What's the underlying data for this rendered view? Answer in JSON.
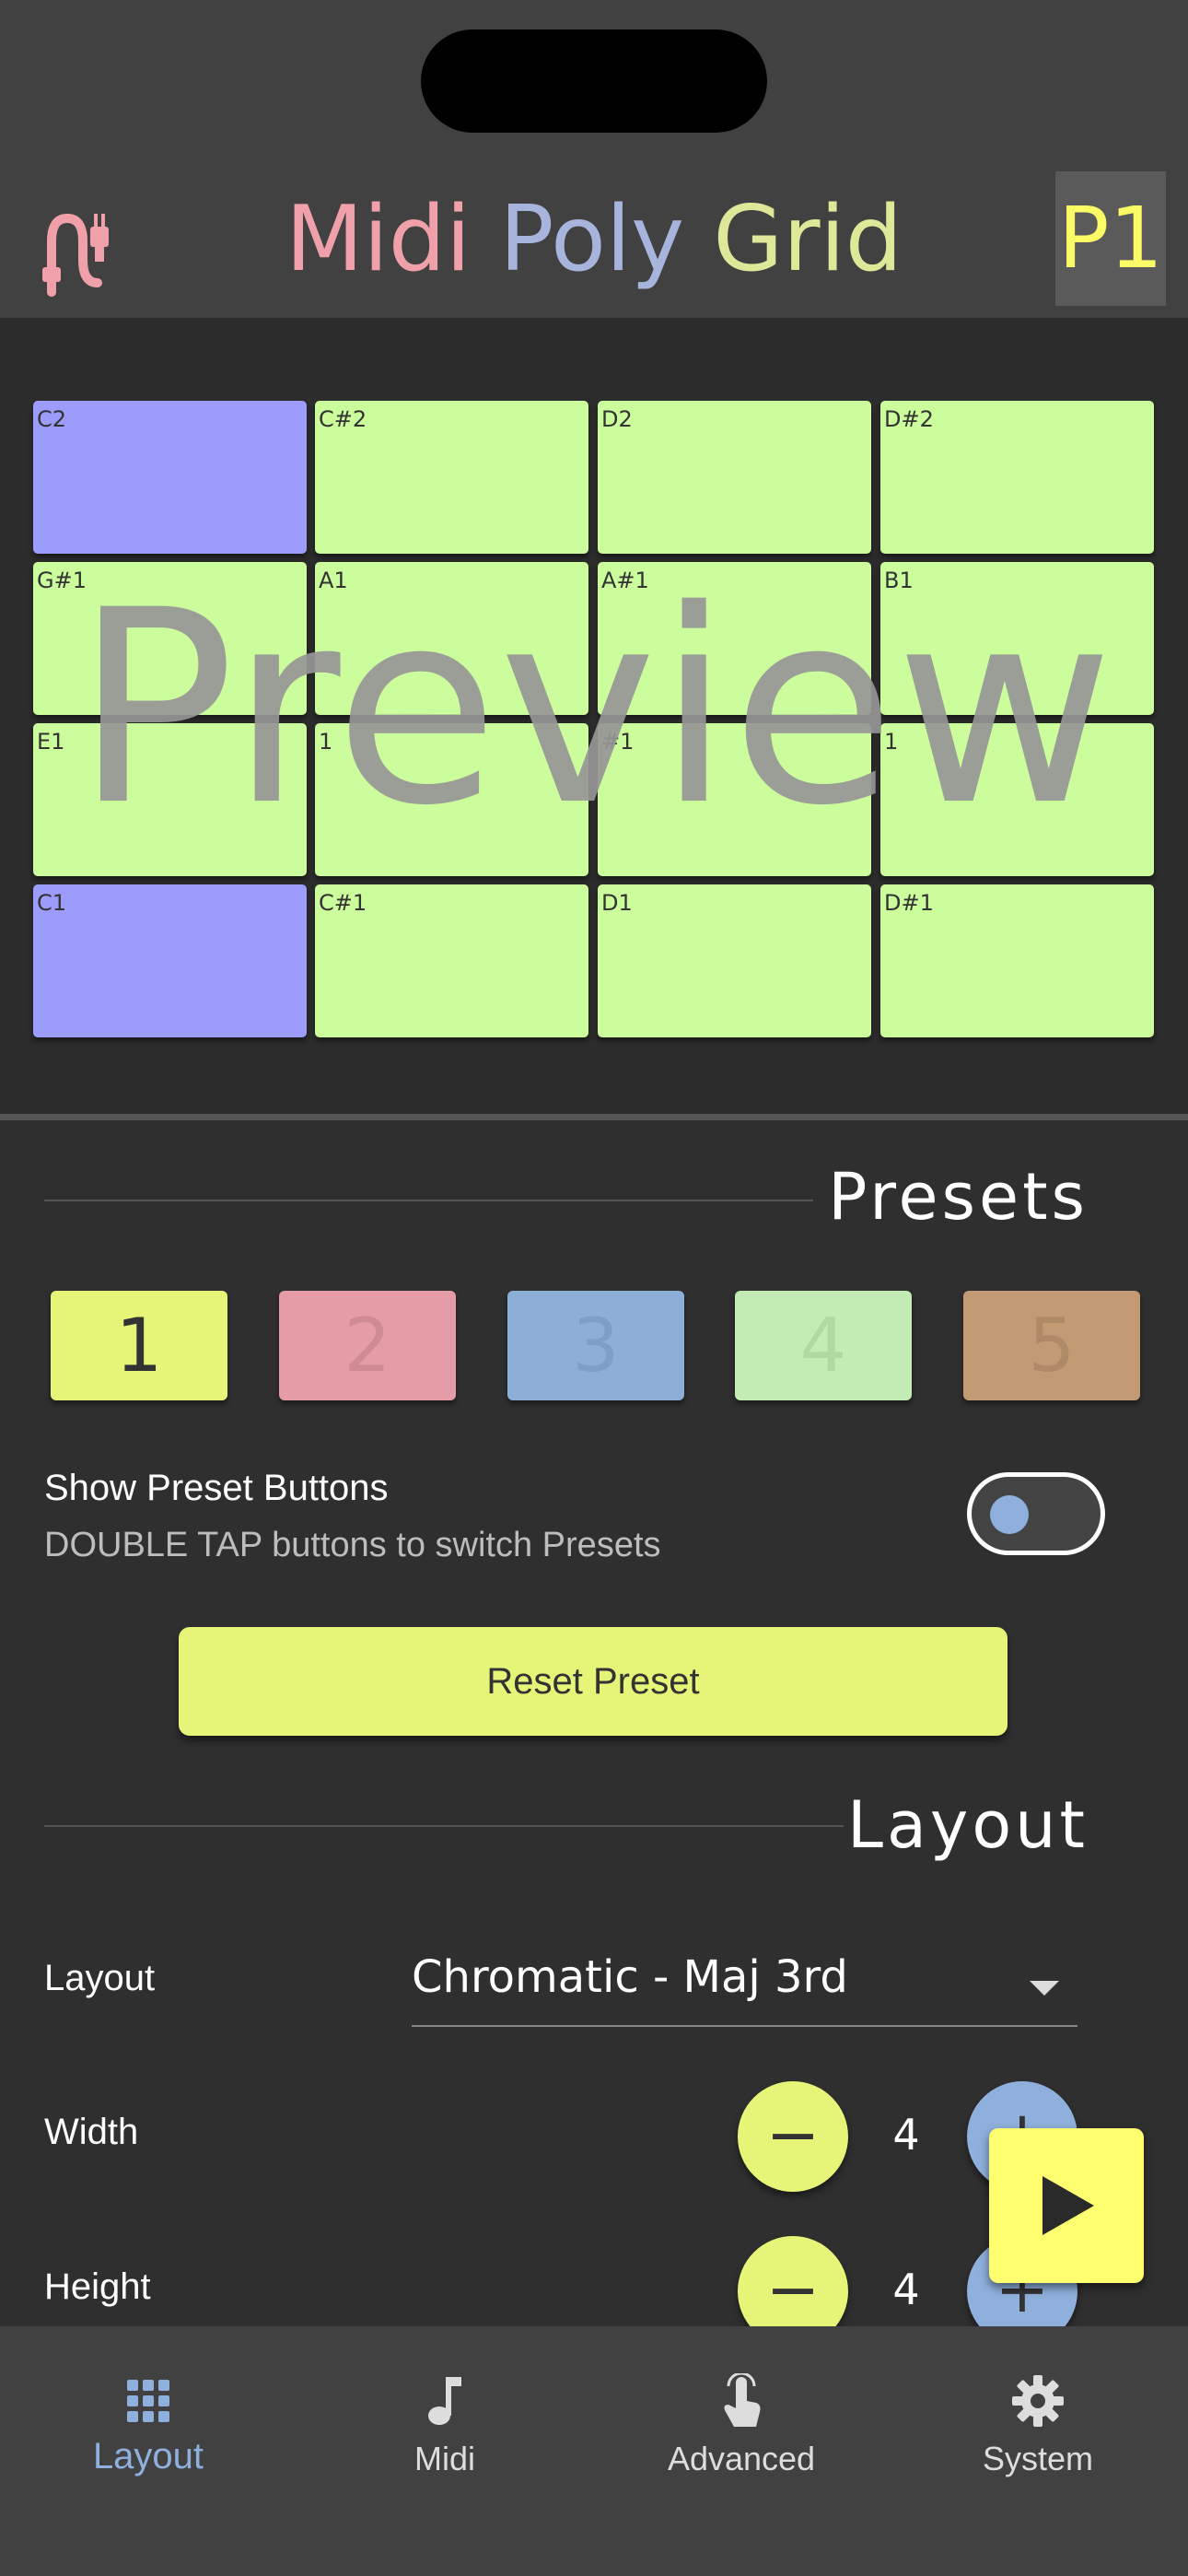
{
  "header": {
    "title_words": [
      "Midi",
      "Poly",
      "Grid"
    ],
    "preset_indicator": "P1",
    "colors": {
      "title_word_1": "#f0a0a8",
      "title_word_2": "#a7b4dc",
      "title_word_3": "#eef090",
      "indicator_text": "#fbfb66"
    }
  },
  "grid": {
    "rows": [
      [
        {
          "label": "C2",
          "color": "#9c9cfd"
        },
        {
          "label": "C#2",
          "color": "#ccfd9c"
        },
        {
          "label": "D2",
          "color": "#ccfd9c"
        },
        {
          "label": "D#2",
          "color": "#ccfd9c"
        }
      ],
      [
        {
          "label": "G#1",
          "color": "#ccfd9c"
        },
        {
          "label": "A1",
          "color": "#ccfd9c"
        },
        {
          "label": "A#1",
          "color": "#ccfd9c"
        },
        {
          "label": "B1",
          "color": "#ccfd9c"
        }
      ],
      [
        {
          "label": "E1",
          "color": "#ccfd9c"
        },
        {
          "label": "1",
          "color": "#ccfd9c"
        },
        {
          "label": "#1",
          "color": "#ccfd9c"
        },
        {
          "label": "1",
          "color": "#ccfd9c"
        }
      ],
      [
        {
          "label": "C1",
          "color": "#9c9cfd"
        },
        {
          "label": "C#1",
          "color": "#ccfd9c"
        },
        {
          "label": "D1",
          "color": "#ccfd9c"
        },
        {
          "label": "D#1",
          "color": "#ccfd9c"
        }
      ]
    ],
    "overlay_text": "Preview"
  },
  "presets": {
    "section_title": "Presets",
    "buttons": [
      {
        "label": "1",
        "color": "#e6f478",
        "text_color": "#333333"
      },
      {
        "label": "2",
        "color": "#e59ca6",
        "text_color": "#d08a94"
      },
      {
        "label": "3",
        "color": "#8daed6",
        "text_color": "#7d9ec6"
      },
      {
        "label": "4",
        "color": "#c3ecb4",
        "text_color": "#b0d9a2"
      },
      {
        "label": "5",
        "color": "#c39a74",
        "text_color": "#b08a66"
      }
    ],
    "show_buttons_label": "Show Preset Buttons",
    "show_buttons_hint": "DOUBLE TAP buttons to switch Presets",
    "show_buttons_enabled": false,
    "reset_label": "Reset Preset"
  },
  "layout": {
    "section_title": "Layout",
    "layout_label": "Layout",
    "layout_value": "Chromatic - Maj 3rd",
    "width_label": "Width",
    "width_value": "4",
    "height_label": "Height",
    "height_value": "4",
    "minus_symbol": "−",
    "plus_symbol": "+"
  },
  "tabs": [
    {
      "label": "Layout",
      "icon": "grid-icon",
      "active": true
    },
    {
      "label": "Midi",
      "icon": "music-note-icon",
      "active": false
    },
    {
      "label": "Advanced",
      "icon": "touch-icon",
      "active": false
    },
    {
      "label": "System",
      "icon": "gear-icon",
      "active": false
    }
  ]
}
